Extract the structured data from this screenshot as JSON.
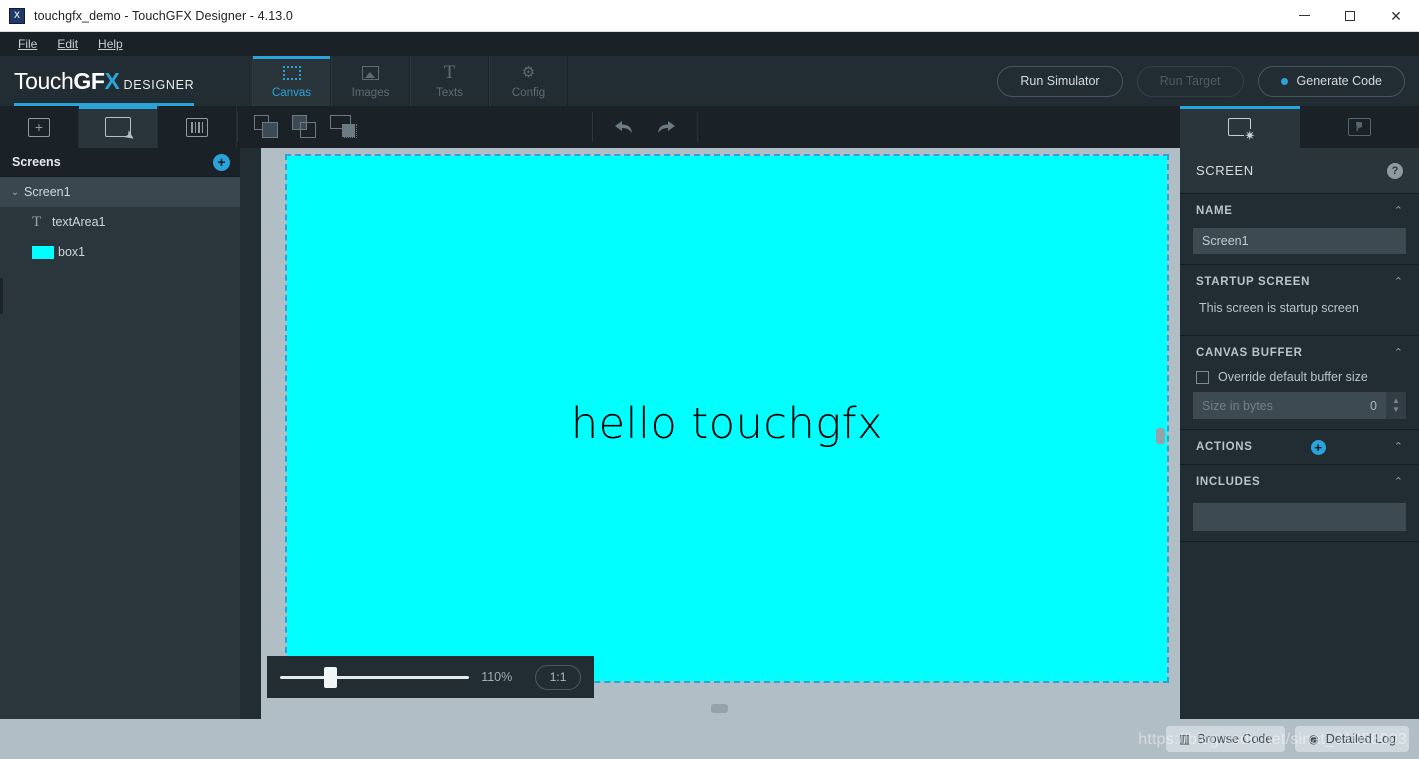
{
  "window": {
    "title": "touchgfx_demo - TouchGFX Designer - 4.13.0",
    "app_icon": "touchgfx-app-icon",
    "minimize": "—",
    "maximize": "□",
    "close": "✕"
  },
  "menubar": {
    "items": [
      {
        "label": "File"
      },
      {
        "label": "Edit"
      },
      {
        "label": "Help"
      }
    ]
  },
  "brand": {
    "part1": "Touch",
    "part2": "GF",
    "part3": "X",
    "suffix": "DESIGNER",
    "accent_color": "#2aa3d8"
  },
  "header_tabs": [
    {
      "label": "Canvas",
      "icon": "canvas-icon",
      "active": true
    },
    {
      "label": "Images",
      "icon": "images-icon",
      "active": false
    },
    {
      "label": "Texts",
      "icon": "texts-icon",
      "active": false
    },
    {
      "label": "Config",
      "icon": "config-icon",
      "active": false
    }
  ],
  "header_actions": {
    "run_simulator": "Run Simulator",
    "run_target": "Run Target",
    "generate_code": "Generate Code"
  },
  "toolbar": {
    "tabs": [
      {
        "name": "add-widget",
        "icon": "plus-box-icon",
        "active": false
      },
      {
        "name": "select-tool",
        "icon": "screen-cursor-icon",
        "active": true
      },
      {
        "name": "widgets-tool",
        "icon": "sliders-icon",
        "active": false
      }
    ],
    "arrange": [
      {
        "name": "send-to-back",
        "icon": "send-to-back-icon"
      },
      {
        "name": "bring-to-front",
        "icon": "bring-to-front-icon"
      },
      {
        "name": "align-to-screen",
        "icon": "align-screen-icon"
      }
    ],
    "undo": "undo-icon",
    "redo": "redo-icon"
  },
  "sidebar": {
    "title": "Screens",
    "add_label": "+",
    "tree": [
      {
        "label": "Screen1",
        "icon": "chevron-down-icon",
        "selected": true,
        "level": 0
      },
      {
        "label": "textArea1",
        "icon": "text-icon",
        "selected": false,
        "level": 1
      },
      {
        "label": "box1",
        "icon": "box-color-swatch",
        "swatch": "#00ffff",
        "selected": false,
        "level": 1
      }
    ]
  },
  "canvas": {
    "screen_text": "hello touchgfx",
    "screen_bg": "#00ffff",
    "canvas_bg": "#b2bec6",
    "selection_color": "#2aa3d8",
    "zoom_percent": "110%",
    "zoom_value": 110,
    "ratio_button": "1:1"
  },
  "properties": {
    "tabs": [
      {
        "name": "screen-properties",
        "icon": "screen-gear-icon",
        "active": true
      },
      {
        "name": "interactions",
        "icon": "screen-pointer-icon",
        "active": false
      }
    ],
    "section_title": "SCREEN",
    "help": "?",
    "name_group": {
      "label": "NAME",
      "value": "Screen1",
      "caret": "⌃"
    },
    "startup_group": {
      "label": "STARTUP SCREEN",
      "note": "This screen is startup screen",
      "caret": "⌃"
    },
    "canvas_buffer_group": {
      "label": "CANVAS BUFFER",
      "checkbox_label": "Override default buffer size",
      "checked": false,
      "size_placeholder": "Size in bytes",
      "size_value": "0",
      "caret": "⌃"
    },
    "actions_group": {
      "label": "ACTIONS",
      "add_label": "+",
      "caret": "⌃"
    },
    "includes_group": {
      "label": "INCLUDES",
      "value": "",
      "caret": "⌃"
    }
  },
  "statusbar": {
    "browse_code": "Browse Code",
    "browse_code_icon": "folder-code-icon",
    "detailed_log": "Detailed Log",
    "detailed_log_icon": "log-circle-icon",
    "watermark": "https://blog.csdn.net/sinat_31058003"
  }
}
